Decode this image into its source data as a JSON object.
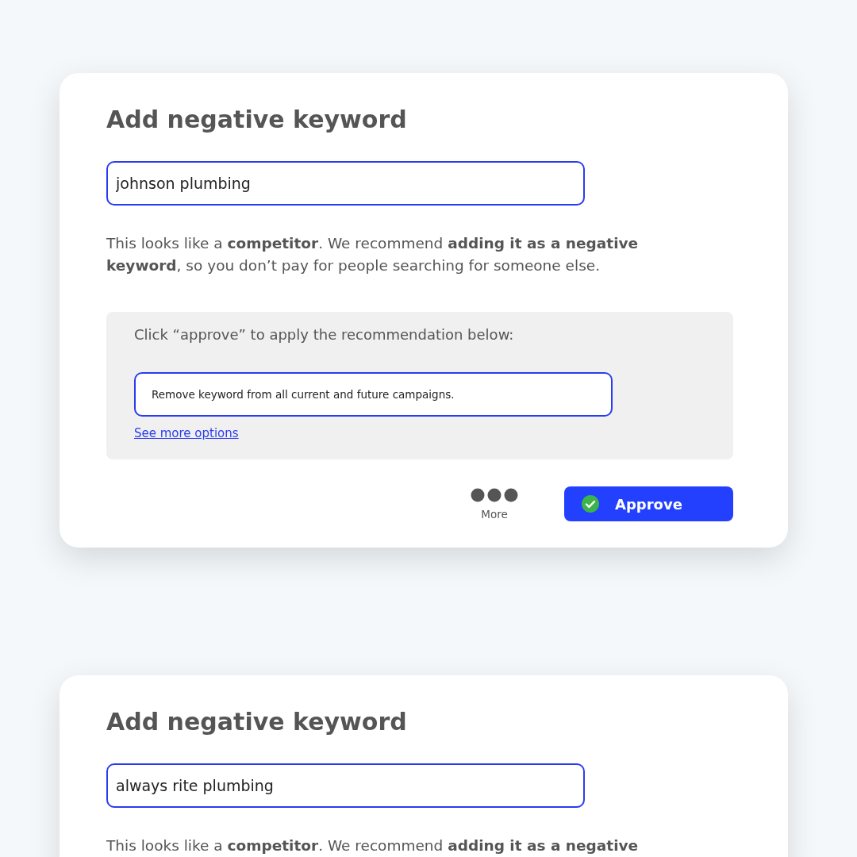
{
  "cards": [
    {
      "title": "Add negative keyword",
      "keyword": "johnson plumbing",
      "description": "This looks like a **competitor**. We recommend **adding it as a negative keyword**, so you don’t pay for people searching for someone else.",
      "recommendation": {
        "instruction": "Click “approve” to apply the recommendation below:",
        "option": "Remove keyword from all current and future campaigns.",
        "link": "See more options"
      },
      "more_label": "More",
      "approve_label": "Approve"
    },
    {
      "title": "Add negative keyword",
      "keyword": "always rite plumbing",
      "description": "This looks like a **competitor**. We recommend **adding it as a negative**"
    }
  ]
}
